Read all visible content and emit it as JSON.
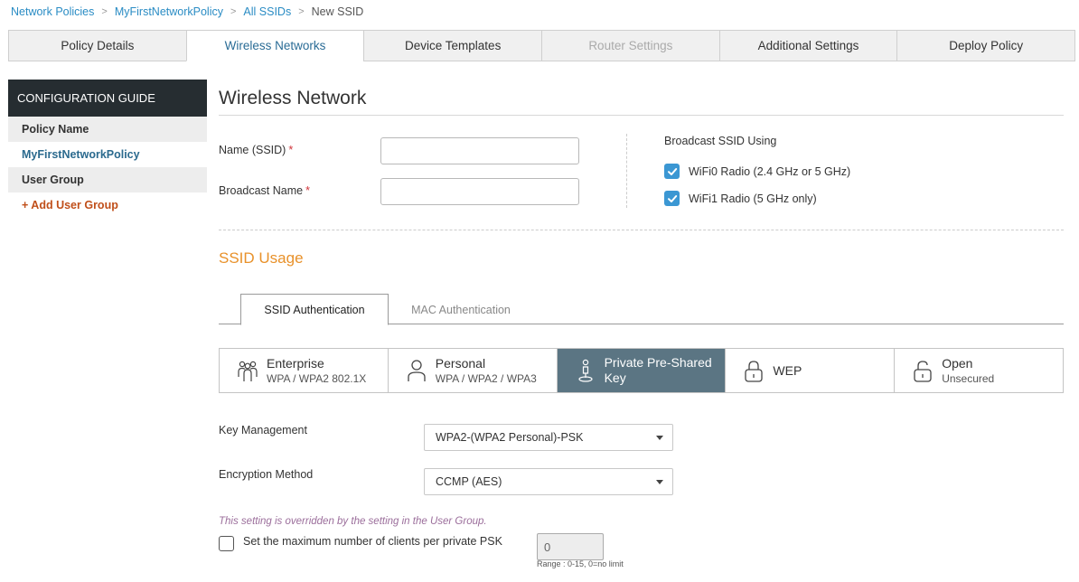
{
  "breadcrumb": {
    "items": [
      "Network Policies",
      "MyFirstNetworkPolicy",
      "All SSIDs"
    ],
    "current": "New SSID",
    "separator": ">"
  },
  "top_tabs": [
    {
      "label": "Policy Details",
      "state": "normal"
    },
    {
      "label": "Wireless Networks",
      "state": "active"
    },
    {
      "label": "Device Templates",
      "state": "normal"
    },
    {
      "label": "Router Settings",
      "state": "disabled"
    },
    {
      "label": "Additional Settings",
      "state": "normal"
    },
    {
      "label": "Deploy Policy",
      "state": "normal"
    }
  ],
  "sidebar": {
    "header": "CONFIGURATION GUIDE",
    "policy_name_label": "Policy Name",
    "policy_name_value": "MyFirstNetworkPolicy",
    "user_group_label": "User Group",
    "add_user_group": "+ Add User Group"
  },
  "main": {
    "title": "Wireless Network",
    "name_label": "Name (SSID)",
    "name_value": "",
    "broadcast_name_label": "Broadcast Name",
    "broadcast_name_value": "",
    "required_marker": "*",
    "broadcast_using_title": "Broadcast SSID Using",
    "radios": [
      {
        "label": "WiFi0 Radio (2.4 GHz or 5 GHz)",
        "checked": true
      },
      {
        "label": "WiFi1 Radio (5 GHz only)",
        "checked": true
      }
    ],
    "ssid_usage_title": "SSID Usage",
    "sub_tabs": {
      "active": "SSID Authentication",
      "inactive": "MAC Authentication"
    },
    "auth_options": [
      {
        "name": "Enterprise",
        "sub": "WPA / WPA2 802.1X",
        "icon": "users-icon",
        "selected": false
      },
      {
        "name": "Personal",
        "sub": "WPA / WPA2 / WPA3",
        "icon": "user-icon",
        "selected": false
      },
      {
        "name": "Private Pre-Shared Key",
        "sub": "",
        "icon": "key-person-icon",
        "selected": true
      },
      {
        "name": "WEP",
        "sub": "",
        "icon": "lock-icon",
        "selected": false
      },
      {
        "name": "Open",
        "sub": "Unsecured",
        "icon": "unlock-icon",
        "selected": false
      }
    ],
    "key_management_label": "Key Management",
    "key_management_value": "WPA2-(WPA2 Personal)-PSK",
    "encryption_label": "Encryption Method",
    "encryption_value": "CCMP (AES)",
    "override_note": "This setting is overridden by the setting in the User Group.",
    "max_clients_label": "Set the maximum number of clients per private PSK",
    "max_clients_checked": false,
    "max_clients_value": "0",
    "range_hint": "Range : 0-15, 0=no limit"
  },
  "colors": {
    "accent_blue": "#2a8cc4",
    "section_orange": "#e8912a",
    "selected_option": "#5b7583",
    "add_link": "#c04f1a",
    "sidebar_header": "#262d31"
  }
}
